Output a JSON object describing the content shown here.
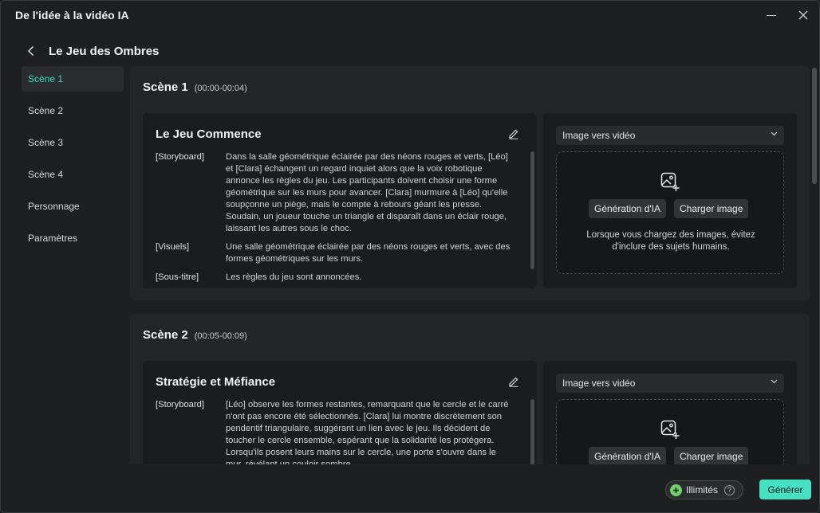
{
  "window": {
    "title": "De l'idée à la vidéo IA"
  },
  "header": {
    "title": "Le Jeu des Ombres"
  },
  "sidebar": {
    "items": [
      {
        "label": "Scène 1",
        "active": true
      },
      {
        "label": "Scène 2",
        "active": false
      },
      {
        "label": "Scène 3",
        "active": false
      },
      {
        "label": "Scène 4",
        "active": false
      },
      {
        "label": "Personnage",
        "active": false
      },
      {
        "label": "Paramètres",
        "active": false
      }
    ]
  },
  "scenes": [
    {
      "name": "Scène 1",
      "time": "(00:00-00:04)",
      "card_title": "Le Jeu Commence",
      "rows": [
        {
          "label": "[Storyboard]",
          "text": "Dans la salle géométrique éclairée par des néons rouges et verts, [Léo] et [Clara] échangent un regard inquiet alors que la voix robotique annonce les règles du jeu. Les participants doivent choisir une forme géométrique sur les murs pour avancer. [Clara] murmure à [Léo] qu'elle soupçonne un piège, mais le compte à rebours géant les presse. Soudain, un joueur touche un triangle et disparaît dans un éclair rouge, laissant les autres sous le choc."
        },
        {
          "label": "[Visuels]",
          "text": "Une salle géométrique éclairée par des néons rouges et verts, avec des formes géométriques sur les murs."
        },
        {
          "label": "[Sous-titre]",
          "text": "Les règles du jeu sont annoncées."
        }
      ],
      "mode": "Image vers vidéo",
      "ai_button": "Génération d'IA",
      "upload_button": "Charger image",
      "note": "Lorsque vous chargez des images, évitez d'inclure des sujets humains."
    },
    {
      "name": "Scène 2",
      "time": "(00:05-00:09)",
      "card_title": "Stratégie et Méfiance",
      "rows": [
        {
          "label": "[Storyboard]",
          "text": "[Léo] observe les formes restantes, remarquant que le cercle et le carré n'ont pas encore été sélectionnés. [Clara] lui montre discrètement son pendentif triangulaire, suggérant un lien avec le jeu. Ils décident de toucher le cercle ensemble, espérant que la solidarité les protégera. Lorsqu'ils posent leurs mains sur le cercle, une porte s'ouvre dans le mur, révélant un couloir sombre."
        }
      ],
      "mode": "Image vers vidéo",
      "ai_button": "Génération d'IA",
      "upload_button": "Charger image"
    }
  ],
  "footer": {
    "plan_label": "Illimités",
    "help_glyph": "?",
    "generate_label": "Générer"
  },
  "colors": {
    "accent": "#46e0c2",
    "active_nav": "#38e0bc",
    "plan_icon": "#6fd36a"
  }
}
